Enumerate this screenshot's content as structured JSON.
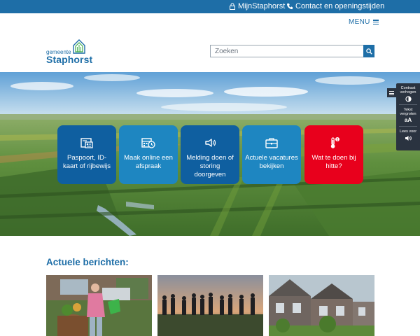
{
  "topbar": {
    "mijn_label": "MijnStaphorst",
    "contact_label": "Contact en openingstijden",
    "mijn_icon": "lock-icon",
    "contact_icon": "phone-icon"
  },
  "header": {
    "menu_label": "MENU",
    "logo_small": "gemeente",
    "logo_big": "Staphorst"
  },
  "search": {
    "placeholder": "Zoeken",
    "value": ""
  },
  "tiles": [
    {
      "label": "Paspoort, ID-kaart of rijbewijs",
      "icon": "id-card-icon"
    },
    {
      "label": "Maak online een afspraak",
      "icon": "calendar-clock-icon"
    },
    {
      "label": "Melding doen of storing doorgeven",
      "icon": "megaphone-icon"
    },
    {
      "label": "Actuele vacatures bekijken",
      "icon": "briefcase-icon"
    },
    {
      "label": "Wat te doen bij hitte?",
      "icon": "thermometer-alert-icon"
    }
  ],
  "accessibility": {
    "contrast_label": "Contrast verhogen",
    "text_label": "Tekst vergroten",
    "text_glyph": "aA",
    "read_label": "Lees voor"
  },
  "news": {
    "title": "Actuele berichten:"
  },
  "colors": {
    "brand_blue": "#1e6ea7",
    "tile_dark": "#0f5fa0",
    "tile_mid": "#1e86c1",
    "alert_red": "#e8001c"
  }
}
